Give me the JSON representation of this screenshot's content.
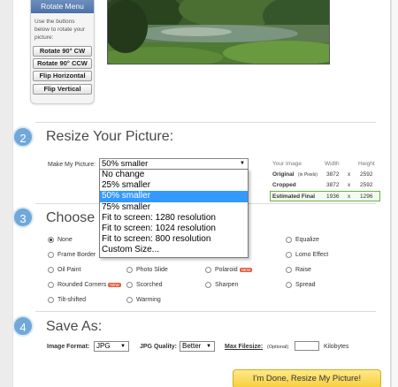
{
  "rotate_menu": {
    "title": "Rotate Menu",
    "hint": "Use the buttons below to rotate your picture:",
    "buttons": [
      "Rotate 90° CW",
      "Rotate 90° CCW",
      "Flip Horizontal",
      "Flip Vertical"
    ]
  },
  "step2": {
    "number": "2",
    "title": "Resize Your Picture:",
    "make_label": "Make My Picture:",
    "selected": "50% smaller",
    "options": [
      "No change",
      "25% smaller",
      "50% smaller",
      "75% smaller",
      "Fit to screen: 1280 resolution",
      "Fit to screen: 1024 resolution",
      "Fit to screen: 800 resolution",
      "Custom Size..."
    ],
    "size_table": {
      "headers": [
        "Your Image",
        "Width",
        "Height"
      ],
      "rows": [
        {
          "label": "Original",
          "note": "(in Pixels)",
          "width": "3872",
          "x": "x",
          "height": "2592"
        },
        {
          "label": "Cropped",
          "note": "",
          "width": "3872",
          "x": "x",
          "height": "2592"
        },
        {
          "label": "Estimated Final",
          "note": "",
          "width": "1936",
          "x": "x",
          "height": "1296"
        }
      ]
    }
  },
  "step3": {
    "number": "3",
    "title": "Choose S",
    "effects": {
      "none": "None",
      "frame_border": "Frame Border",
      "oil_paint": "Oil Paint",
      "photo_slide": "Photo Slide",
      "polaroid": "Polaroid",
      "rounded_corners": "Rounded Corners",
      "scorched": "Scorched",
      "sharpen": "Sharpen",
      "tilt_shifted": "Tilt-shifted",
      "warming": "Warming",
      "equalize": "Equalize",
      "lomo_effect": "Lomo Effect",
      "raise": "Raise",
      "spread": "Spread"
    },
    "new_badge": "NEW"
  },
  "step4": {
    "number": "4",
    "title": "Save As:",
    "format_label": "Image Format:",
    "format_value": "JPG",
    "quality_label": "JPG Quality:",
    "quality_value": "Better",
    "filesize_label": "Max Filesize:",
    "filesize_note": "(Optional)",
    "filesize_value": "",
    "filesize_unit": "Kilobytes"
  },
  "done_button": "I'm Done, Resize My Picture!",
  "colors": {
    "accent": "#6fa8d9",
    "selection": "#3399ff",
    "done_button": "#f6cf3c",
    "estimated_border": "#6ab04c"
  }
}
